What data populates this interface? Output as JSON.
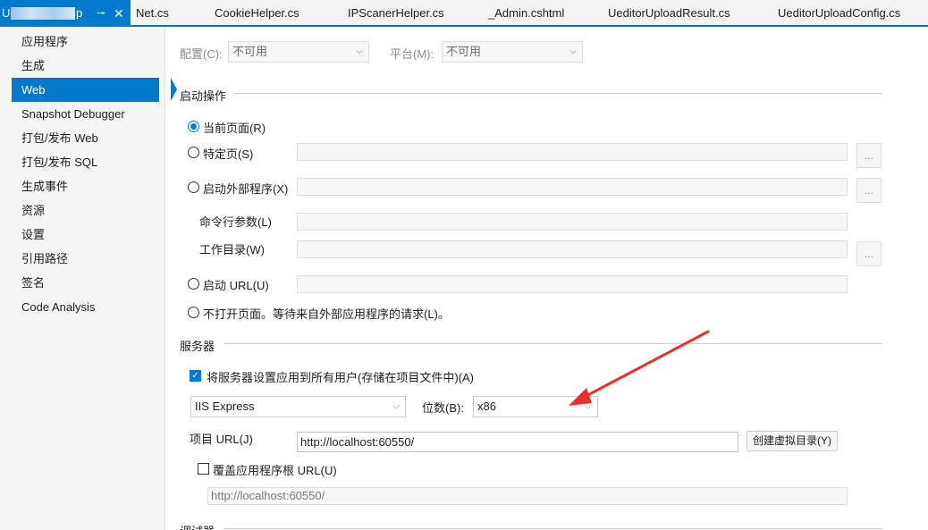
{
  "tabs": [
    {
      "label": "Net.cs"
    },
    {
      "label": "CookieHelper.cs"
    },
    {
      "label": "IPScanerHelper.cs"
    },
    {
      "label": "_Admin.cshtml"
    },
    {
      "label": "UeditorUploadResult.cs"
    },
    {
      "label": "UeditorUploadConfig.cs"
    }
  ],
  "active_tab": {
    "visible_prefix": "U",
    "visible_suffix": "p",
    "pin_glyph": "⊸",
    "close_glyph": "✕"
  },
  "sidebar": {
    "items": [
      {
        "label": "应用程序"
      },
      {
        "label": "生成"
      },
      {
        "label": "Web",
        "active": true
      },
      {
        "label": "Snapshot Debugger"
      },
      {
        "label": "打包/发布 Web"
      },
      {
        "label": "打包/发布 SQL"
      },
      {
        "label": "生成事件"
      },
      {
        "label": "资源"
      },
      {
        "label": "设置"
      },
      {
        "label": "引用路径"
      },
      {
        "label": "签名"
      },
      {
        "label": "Code Analysis"
      }
    ]
  },
  "config_bar": {
    "config_label": "配置(C):",
    "config_value": "不可用",
    "platform_label": "平台(M):",
    "platform_value": "不可用"
  },
  "startup": {
    "section_title": "启动操作",
    "current_page": "当前页面(R)",
    "specific_page": "特定页(S)",
    "start_external": "启动外部程序(X)",
    "cmd_args": "命令行参数(L)",
    "working_dir": "工作目录(W)",
    "start_url": "启动 URL(U)",
    "dont_open": "不打开页面。等待来自外部应用程序的请求(L)。",
    "browse_glyph": "..."
  },
  "server": {
    "section_title": "服务器",
    "apply_all_users": "将服务器设置应用到所有用户(存储在项目文件中)(A)",
    "server_type": "IIS Express",
    "bitness_label": "位数(B):",
    "bitness_value": "x86",
    "project_url_label": "项目 URL(J)",
    "project_url_value": "http://localhost:60550/",
    "create_vdir_button": "创建虚拟目录(Y)",
    "override_root": "覆盖应用程序根 URL(U)",
    "override_url_value": "http://localhost:60550/"
  },
  "debugger": {
    "section_title": "调试器"
  },
  "colors": {
    "accent": "#007acc",
    "annotation_arrow": "#e8312a"
  },
  "icons": {
    "check": "✓",
    "chevron": "⌵"
  }
}
